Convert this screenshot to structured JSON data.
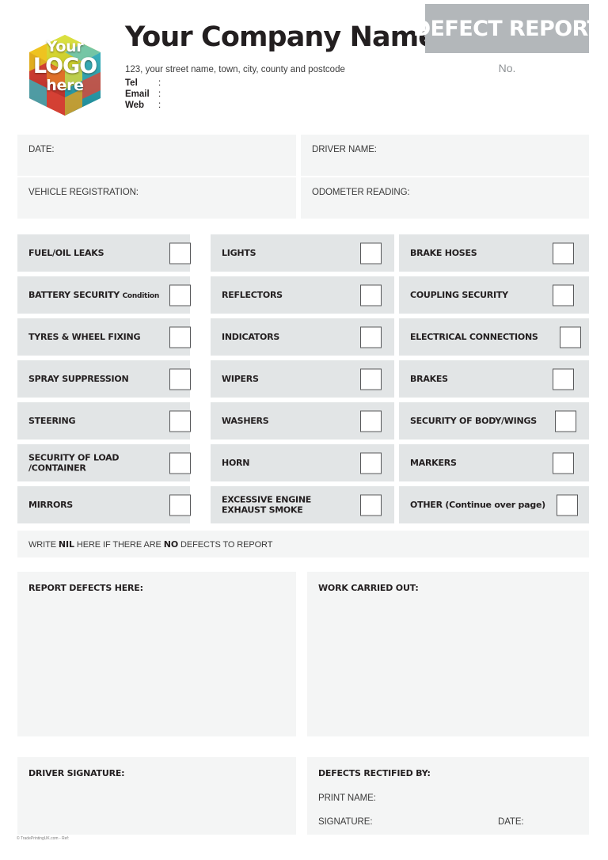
{
  "document": {
    "title": "DEFECT REPORT",
    "number_label": "No.",
    "footer_credit": "© TradePrintingUK.com - Ref:"
  },
  "colors": {
    "banner_gray": "#b3b7ba",
    "row_gray": "#e2e5e6",
    "panel_gray": "#f4f5f5",
    "text_dark": "#231f20"
  },
  "logo": {
    "line1": "Your",
    "line2": "LOGO",
    "line3": "here",
    "icon": "puzzle-cube-logo"
  },
  "company": {
    "name": "Your Company Name",
    "address": "123, your street name, town, city, county and postcode",
    "contacts": [
      {
        "label": "Tel",
        "colon": ":",
        "value": ""
      },
      {
        "label": "Email",
        "colon": ":",
        "value": ""
      },
      {
        "label": "Web",
        "colon": ":",
        "value": ""
      }
    ]
  },
  "info_fields": [
    {
      "label": "DATE:",
      "value": ""
    },
    {
      "label": "DRIVER NAME:",
      "value": ""
    },
    {
      "label": "VEHICLE REGISTRATION:",
      "value": ""
    },
    {
      "label": "ODOMETER READING:",
      "value": ""
    }
  ],
  "checklist": {
    "columns": [
      [
        {
          "label": "FUEL/OIL LEAKS",
          "checked": false
        },
        {
          "label": "BATTERY SECURITY",
          "sub": "Condition",
          "checked": false
        },
        {
          "label": "TYRES & WHEEL FIXING",
          "checked": false
        },
        {
          "label": "SPRAY SUPPRESSION",
          "checked": false
        },
        {
          "label": "STEERING",
          "checked": false
        },
        {
          "label": "SECURITY OF LOAD\n/CONTAINER",
          "checked": false
        },
        {
          "label": "MIRRORS",
          "checked": false
        }
      ],
      [
        {
          "label": "LIGHTS",
          "checked": false
        },
        {
          "label": "REFLECTORS",
          "checked": false
        },
        {
          "label": "INDICATORS",
          "checked": false
        },
        {
          "label": "WIPERS",
          "checked": false
        },
        {
          "label": "WASHERS",
          "checked": false
        },
        {
          "label": "HORN",
          "checked": false
        },
        {
          "label": "EXCESSIVE ENGINE\nEXHAUST SMOKE",
          "checked": false
        }
      ],
      [
        {
          "label": "BRAKE HOSES",
          "checked": false
        },
        {
          "label": "COUPLING SECURITY",
          "checked": false
        },
        {
          "label": "ELECTRICAL CONNECTIONS",
          "checked": false
        },
        {
          "label": "BRAKES",
          "checked": false
        },
        {
          "label": "SECURITY OF BODY/WINGS",
          "checked": false
        },
        {
          "label": "MARKERS",
          "checked": false
        },
        {
          "label": "OTHER (Continue over page)",
          "checked": false
        }
      ]
    ]
  },
  "nil_notice": {
    "part1": "WRITE ",
    "bold1": "NIL",
    "part2": " HERE IF THERE ARE ",
    "bold2": "NO",
    "part3": " DEFECTS TO REPORT"
  },
  "panels": {
    "report_defects": {
      "title": "REPORT DEFECTS HERE:",
      "value": ""
    },
    "work_carried_out": {
      "title": "WORK CARRIED OUT:",
      "value": ""
    },
    "driver_signature": {
      "title": "DRIVER SIGNATURE:",
      "value": ""
    },
    "defects_rectified": {
      "title": "DEFECTS RECTIFIED BY:",
      "print_name": "PRINT NAME:",
      "signature": "SIGNATURE:",
      "date": "DATE:"
    }
  }
}
